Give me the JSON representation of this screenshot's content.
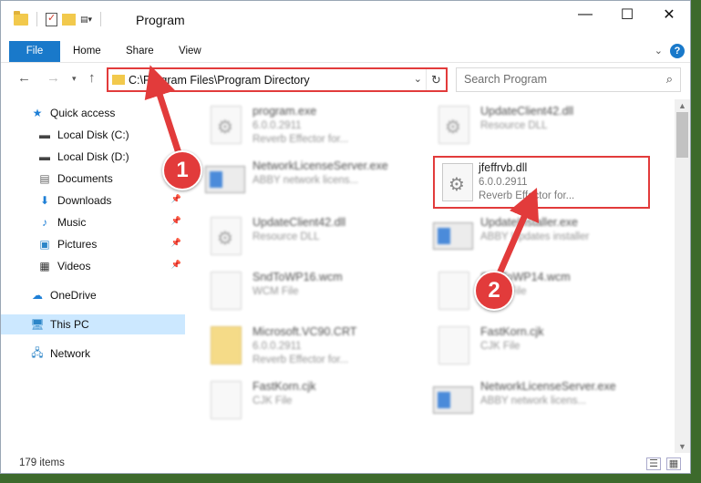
{
  "window": {
    "title": "Program",
    "controls": {
      "minimize": "—",
      "maximize": "☐",
      "close": "✕"
    }
  },
  "ribbon": {
    "tabs": [
      {
        "label": "File"
      },
      {
        "label": "Home"
      },
      {
        "label": "Share"
      },
      {
        "label": "View"
      }
    ],
    "help": "?"
  },
  "address": {
    "path": "C:\\Program Files\\Program Directory",
    "search_placeholder": "Search Program"
  },
  "sidebar": {
    "items": [
      {
        "label": "Quick access",
        "icon": "star-icon"
      },
      {
        "label": "Local Disk (C:)",
        "icon": "drive-icon"
      },
      {
        "label": "Local Disk (D:)",
        "icon": "drive-icon"
      },
      {
        "label": "Documents",
        "icon": "documents-icon"
      },
      {
        "label": "Downloads",
        "icon": "download-icon",
        "pinned": true
      },
      {
        "label": "Music",
        "icon": "music-icon",
        "pinned": true
      },
      {
        "label": "Pictures",
        "icon": "pictures-icon",
        "pinned": true
      },
      {
        "label": "Videos",
        "icon": "videos-icon",
        "pinned": true
      },
      {
        "label": "OneDrive",
        "icon": "cloud-icon"
      },
      {
        "label": "This PC",
        "icon": "computer-icon",
        "selected": true
      },
      {
        "label": "Network",
        "icon": "network-icon"
      }
    ]
  },
  "files": [
    {
      "name": "program.exe",
      "meta1": "6.0.0.2911",
      "meta2": "Reverb Effector for..."
    },
    {
      "name": "UpdateClient42.dll",
      "meta1": "Resource DLL",
      "meta2": ""
    },
    {
      "name": "NetworkLicenseServer.exe",
      "meta1": "ABBY network licens...",
      "meta2": ""
    },
    {
      "name": "jfeffrvb.dll",
      "meta1": "6.0.0.2911",
      "meta2": "Reverb Effector for..."
    },
    {
      "name": "UpdateClient42.dll",
      "meta1": "Resource DLL",
      "meta2": ""
    },
    {
      "name": "UpdateInstaller.exe",
      "meta1": "ABBY Updates installer",
      "meta2": ""
    },
    {
      "name": "SndToWP16.wcm",
      "meta1": "WCM File",
      "meta2": ""
    },
    {
      "name": "SndToWP14.wcm",
      "meta1": "WCM File",
      "meta2": ""
    },
    {
      "name": "Microsoft.VC90.CRT",
      "meta1": "6.0.0.2911",
      "meta2": "Reverb Effector for..."
    },
    {
      "name": "FastKorn.cjk",
      "meta1": "CJK File",
      "meta2": ""
    },
    {
      "name": "FastKorn.cjk",
      "meta1": "CJK File",
      "meta2": ""
    },
    {
      "name": "NetworkLicenseServer.exe",
      "meta1": "ABBY network licens...",
      "meta2": ""
    }
  ],
  "status": {
    "items_count": "179 items"
  },
  "annotations": {
    "step1": "1",
    "step2": "2"
  },
  "colors": {
    "accent": "#1979ca",
    "highlight": "#e23b3b",
    "selected": "#cce8ff"
  }
}
